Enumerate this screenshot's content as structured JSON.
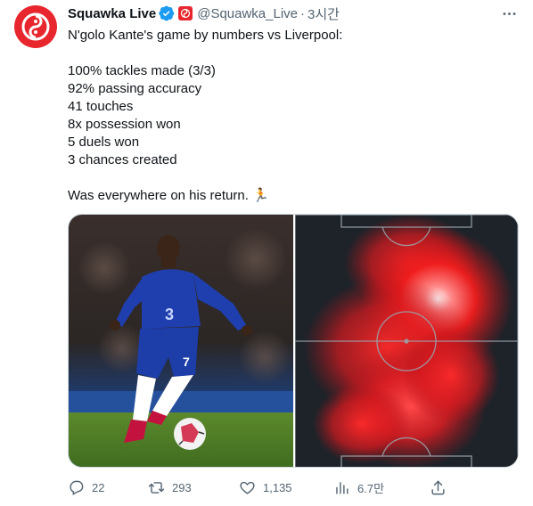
{
  "tweet": {
    "author_name": "Squawka Live",
    "handle": "@Squawka_Live",
    "separator": "·",
    "time": "3시간",
    "lines": [
      "N'golo Kante's game by numbers vs Liverpool:",
      "100% tackles made (3/3)",
      "92% passing accuracy",
      "41 touches",
      "8x possession won",
      "5 duels won",
      "3 chances created",
      "Was everywhere on his return. 🏃"
    ],
    "icons": {
      "avatar": "squawka-logo-icon",
      "verified": "verified-badge-icon",
      "affiliate": "affiliate-badge-icon",
      "more": "more-options-icon"
    }
  },
  "media": {
    "left_image": "player-photo",
    "right_image": "heatmap-pitch",
    "shirt_number": "7",
    "shirt_sponsor": "3"
  },
  "actions": {
    "replies": "22",
    "retweets": "293",
    "likes": "1,135",
    "views": "6.7만"
  },
  "colors": {
    "brand_red": "#e8262d",
    "verified_blue": "#1d9bf0",
    "text_secondary": "#536471"
  }
}
